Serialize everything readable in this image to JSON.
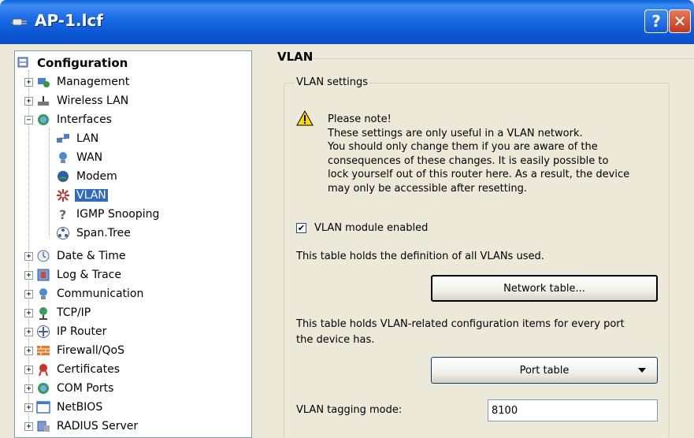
{
  "window": {
    "title": "AP-1.lcf",
    "help_label": "?",
    "close_label": "✕"
  },
  "tree": {
    "root": "Configuration",
    "items": [
      {
        "label": "Management",
        "icon": "management-icon",
        "expander": "+"
      },
      {
        "label": "Wireless LAN",
        "icon": "wireless-lan-icon",
        "expander": "+"
      },
      {
        "label": "Interfaces",
        "icon": "interfaces-icon",
        "expander": "−"
      },
      {
        "label": "LAN",
        "icon": "lan-icon"
      },
      {
        "label": "WAN",
        "icon": "wan-icon"
      },
      {
        "label": "Modem",
        "icon": "modem-icon"
      },
      {
        "label": "VLAN",
        "icon": "vlan-icon",
        "selected": true
      },
      {
        "label": "IGMP Snooping",
        "icon": "question-icon"
      },
      {
        "label": "Span.Tree",
        "icon": "span-tree-icon"
      },
      {
        "label": "Date & Time",
        "icon": "clock-icon",
        "expander": "+"
      },
      {
        "label": "Log & Trace",
        "icon": "log-icon",
        "expander": "+"
      },
      {
        "label": "Communication",
        "icon": "communication-icon",
        "expander": "+"
      },
      {
        "label": "TCP/IP",
        "icon": "tcpip-icon",
        "expander": "+"
      },
      {
        "label": "IP Router",
        "icon": "router-icon",
        "expander": "+"
      },
      {
        "label": "Firewall/QoS",
        "icon": "firewall-icon",
        "expander": "+"
      },
      {
        "label": "Certificates",
        "icon": "certificate-icon",
        "expander": "+"
      },
      {
        "label": "COM Ports",
        "icon": "com-ports-icon",
        "expander": "+"
      },
      {
        "label": "NetBIOS",
        "icon": "netbios-icon",
        "expander": "+"
      },
      {
        "label": "RADIUS Server",
        "icon": "radius-icon",
        "expander": "+"
      }
    ]
  },
  "panel": {
    "title": "VLAN",
    "group_label": "VLAN settings",
    "note_lines": [
      "Please note!",
      "These settings are only useful in a VLAN network.",
      "You should only change them if you are aware of the",
      "consequences of these changes. It is easily possible to",
      "lock yourself out of this router here. As a result, the device",
      "may only be accessible after resetting."
    ],
    "checkbox_label": "VLAN module enabled",
    "checkbox_checked": true,
    "info_1": "This table holds the definition of all VLANs used.",
    "network_button": "Network table...",
    "info_2_line1": "This table holds VLAN-related configuration items for every port",
    "info_2_line2": "the device has.",
    "port_button": "Port table",
    "tagging_label": "VLAN tagging mode:",
    "tagging_value": "8100"
  }
}
